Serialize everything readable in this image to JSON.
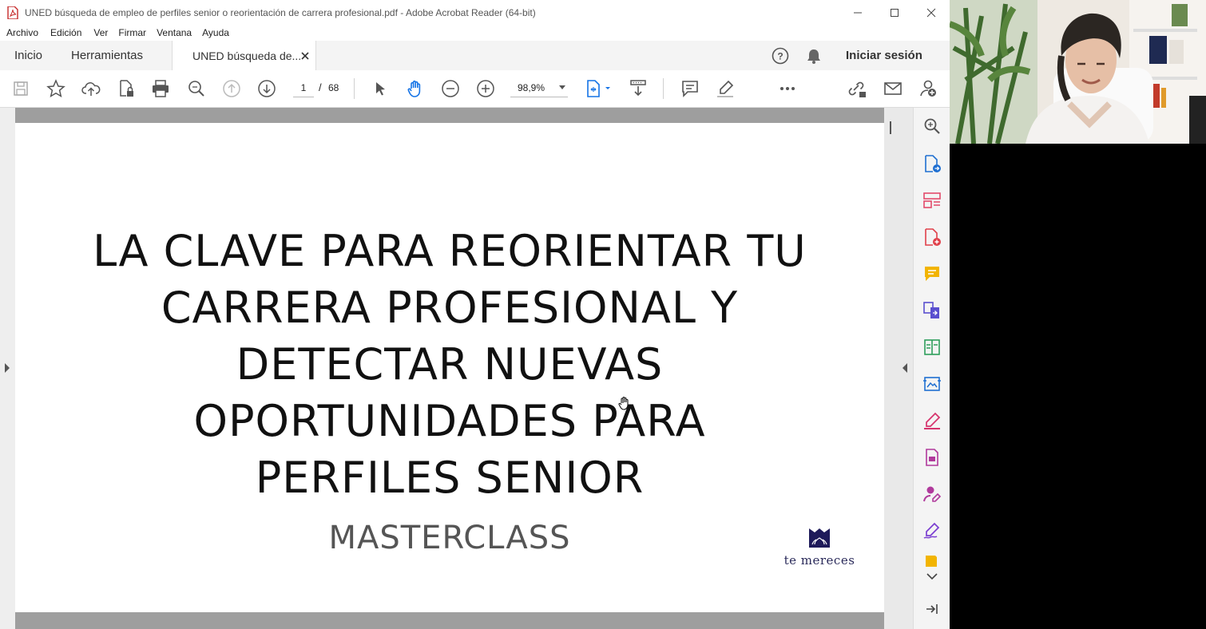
{
  "window": {
    "title": "UNED búsqueda de empleo de perfiles senior o reorientación de carrera profesional.pdf - Adobe Acrobat Reader (64-bit)"
  },
  "menu": [
    "Archivo",
    "Edición",
    "Ver",
    "Firmar",
    "Ventana",
    "Ayuda"
  ],
  "tabs": {
    "home": "Inicio",
    "tools": "Herramientas",
    "document": "UNED búsqueda de..."
  },
  "header": {
    "signin": "Iniciar sesión"
  },
  "toolbar": {
    "page_current": "1",
    "page_sep": "/",
    "page_total": "68",
    "zoom": "98,9%"
  },
  "document": {
    "headline_lines": [
      "LA CLAVE PARA REORIENTAR TU",
      "CARRERA PROFESIONAL Y",
      "DETECTAR NUEVAS",
      "OPORTUNIDADES PARA",
      "PERFILES SENIOR"
    ],
    "subtitle": "MASTERCLASS",
    "logo_text": "te mereces"
  },
  "colors": {
    "accent_blue": "#1473e6",
    "icon_gray": "#555555",
    "brand_navy": "#1e1a5a"
  }
}
